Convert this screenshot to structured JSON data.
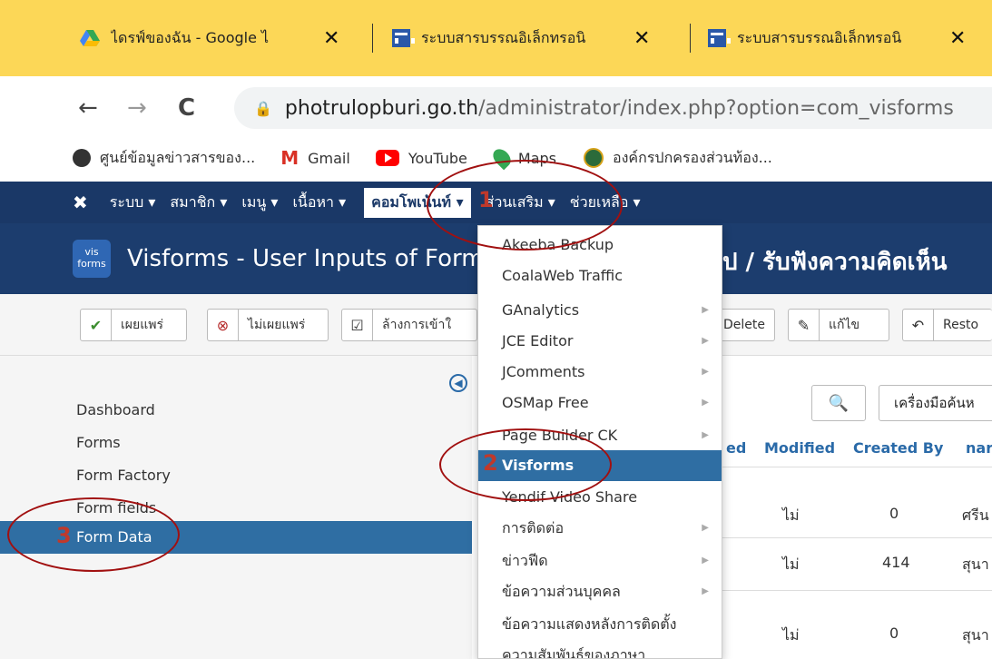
{
  "browser": {
    "tabs": [
      {
        "title": "ไดรฟ์ของฉัน - Google ไ",
        "icon": "google-drive-icon"
      },
      {
        "title": "ระบบสารบรรณอิเล็กทรอนิ",
        "icon": "visforms-icon"
      },
      {
        "title": "ระบบสารบรรณอิเล็กทรอนิ",
        "icon": "visforms-icon"
      }
    ],
    "close_glyph": "✕",
    "back_glyph": "←",
    "forward_glyph": "→",
    "reload_glyph": "C",
    "lock_glyph": "🔒",
    "url_host": "photrulopburi.go.th",
    "url_path": "/administrator/index.php?option=com_visforms",
    "bookmarks": [
      {
        "label": "ศูนย์ข้อมูลข่าวสารของ...",
        "icon": "globe-icon"
      },
      {
        "label": "Gmail",
        "icon": "gmail-icon"
      },
      {
        "label": "YouTube",
        "icon": "youtube-icon"
      },
      {
        "label": "Maps",
        "icon": "maps-icon"
      },
      {
        "label": "องค์กรปกครองส่วนท้อง...",
        "icon": "seal-icon"
      }
    ]
  },
  "admin_nav": {
    "logo_glyph": "✖",
    "items": [
      {
        "label": "ระบบ ▾"
      },
      {
        "label": "สมาชิก ▾"
      },
      {
        "label": "เมนู ▾"
      },
      {
        "label": "เนื้อหา ▾"
      },
      {
        "label": "คอมโพเน้นท์ ▾"
      },
      {
        "label": "ส่วนเสริม ▾"
      },
      {
        "label": "ช่วยเหลือ ▾"
      }
    ]
  },
  "title_bar": {
    "logo_text_1": "vis",
    "logo_text_2": "forms",
    "title": "Visforms - User Inputs of Form",
    "title_suffix": "ป / รับฟังความคิดเห็น"
  },
  "toolbar": {
    "publish": "เผยแพร่",
    "unpublish": "ไม่เผยแพร่",
    "checkin": "ล้างการเข้าใ",
    "delete": "Delete",
    "edit": "แก้ไข",
    "restore": "Resto"
  },
  "sidebar": {
    "items": [
      "Dashboard",
      "Forms",
      "Form Factory",
      "Form fields",
      "Form Data"
    ],
    "active": "Form Data"
  },
  "main": {
    "search_glyph": "🔍",
    "tools_label": "เครื่องมือค้นห",
    "columns": [
      "ed",
      "Modified",
      "Created By",
      "nar"
    ],
    "rows": [
      {
        "modified": "ไม่",
        "created_by": "0",
        "name": "ศรีน"
      },
      {
        "modified": "ไม่",
        "created_by": "414",
        "name": "สุนา"
      },
      {
        "modified": "ไม่",
        "created_by": "0",
        "name": "สุนา"
      }
    ]
  },
  "dropdown": {
    "items": [
      {
        "label": "Akeeba Backup",
        "sub": false
      },
      {
        "label": "CoalaWeb Traffic",
        "sub": false
      },
      {
        "label": "GAnalytics",
        "sub": true
      },
      {
        "label": "JCE Editor",
        "sub": true
      },
      {
        "label": "JComments",
        "sub": true
      },
      {
        "label": "OSMap Free",
        "sub": true
      },
      {
        "label": "Page Builder CK",
        "sub": true
      },
      {
        "label": "Visforms",
        "sub": false
      },
      {
        "label": "Yendif Video Share",
        "sub": false
      },
      {
        "label": "การติดต่อ",
        "sub": true
      },
      {
        "label": "ข่าวฟีด",
        "sub": true
      },
      {
        "label": "ข้อความส่วนบุคคล",
        "sub": true
      },
      {
        "label": "ข้อความแสดงหลังการติดตั้ง",
        "sub": false
      },
      {
        "label": "ความสัมพันธ์ของภาษา",
        "sub": false
      }
    ],
    "active": "Visforms",
    "submenu_glyph": "▶"
  },
  "annotations": [
    {
      "number": "1"
    },
    {
      "number": "2"
    },
    {
      "number": "3"
    }
  ],
  "colors": {
    "tab_strip": "#fcd757",
    "admin_nav": "#1a3867",
    "title_bar": "#1c3d6e",
    "active_item": "#2f6ea3",
    "annotation": "#a11010"
  }
}
